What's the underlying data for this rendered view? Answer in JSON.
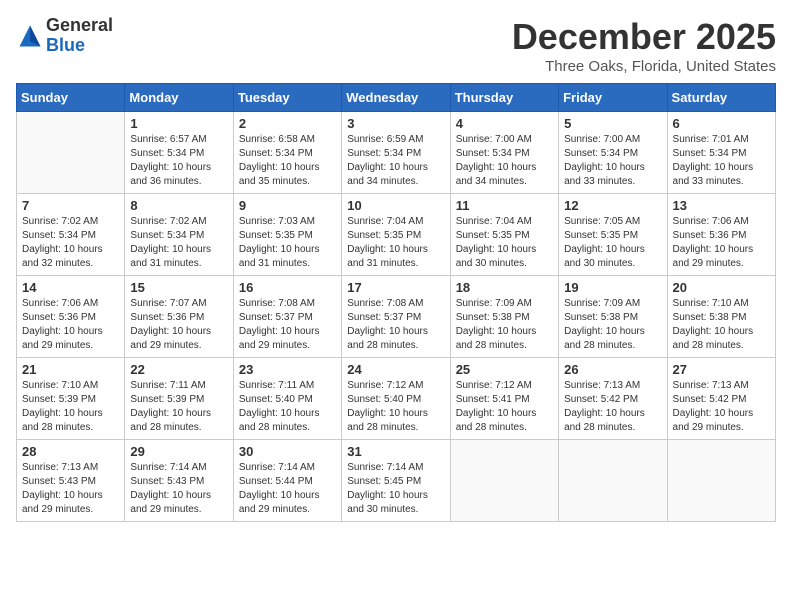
{
  "logo": {
    "general": "General",
    "blue": "Blue"
  },
  "title": "December 2025",
  "location": "Three Oaks, Florida, United States",
  "headers": [
    "Sunday",
    "Monday",
    "Tuesday",
    "Wednesday",
    "Thursday",
    "Friday",
    "Saturday"
  ],
  "weeks": [
    [
      {
        "num": "",
        "sunrise": "",
        "sunset": "",
        "daylight": ""
      },
      {
        "num": "1",
        "sunrise": "Sunrise: 6:57 AM",
        "sunset": "Sunset: 5:34 PM",
        "daylight": "Daylight: 10 hours and 36 minutes."
      },
      {
        "num": "2",
        "sunrise": "Sunrise: 6:58 AM",
        "sunset": "Sunset: 5:34 PM",
        "daylight": "Daylight: 10 hours and 35 minutes."
      },
      {
        "num": "3",
        "sunrise": "Sunrise: 6:59 AM",
        "sunset": "Sunset: 5:34 PM",
        "daylight": "Daylight: 10 hours and 34 minutes."
      },
      {
        "num": "4",
        "sunrise": "Sunrise: 7:00 AM",
        "sunset": "Sunset: 5:34 PM",
        "daylight": "Daylight: 10 hours and 34 minutes."
      },
      {
        "num": "5",
        "sunrise": "Sunrise: 7:00 AM",
        "sunset": "Sunset: 5:34 PM",
        "daylight": "Daylight: 10 hours and 33 minutes."
      },
      {
        "num": "6",
        "sunrise": "Sunrise: 7:01 AM",
        "sunset": "Sunset: 5:34 PM",
        "daylight": "Daylight: 10 hours and 33 minutes."
      }
    ],
    [
      {
        "num": "7",
        "sunrise": "Sunrise: 7:02 AM",
        "sunset": "Sunset: 5:34 PM",
        "daylight": "Daylight: 10 hours and 32 minutes."
      },
      {
        "num": "8",
        "sunrise": "Sunrise: 7:02 AM",
        "sunset": "Sunset: 5:34 PM",
        "daylight": "Daylight: 10 hours and 31 minutes."
      },
      {
        "num": "9",
        "sunrise": "Sunrise: 7:03 AM",
        "sunset": "Sunset: 5:35 PM",
        "daylight": "Daylight: 10 hours and 31 minutes."
      },
      {
        "num": "10",
        "sunrise": "Sunrise: 7:04 AM",
        "sunset": "Sunset: 5:35 PM",
        "daylight": "Daylight: 10 hours and 31 minutes."
      },
      {
        "num": "11",
        "sunrise": "Sunrise: 7:04 AM",
        "sunset": "Sunset: 5:35 PM",
        "daylight": "Daylight: 10 hours and 30 minutes."
      },
      {
        "num": "12",
        "sunrise": "Sunrise: 7:05 AM",
        "sunset": "Sunset: 5:35 PM",
        "daylight": "Daylight: 10 hours and 30 minutes."
      },
      {
        "num": "13",
        "sunrise": "Sunrise: 7:06 AM",
        "sunset": "Sunset: 5:36 PM",
        "daylight": "Daylight: 10 hours and 29 minutes."
      }
    ],
    [
      {
        "num": "14",
        "sunrise": "Sunrise: 7:06 AM",
        "sunset": "Sunset: 5:36 PM",
        "daylight": "Daylight: 10 hours and 29 minutes."
      },
      {
        "num": "15",
        "sunrise": "Sunrise: 7:07 AM",
        "sunset": "Sunset: 5:36 PM",
        "daylight": "Daylight: 10 hours and 29 minutes."
      },
      {
        "num": "16",
        "sunrise": "Sunrise: 7:08 AM",
        "sunset": "Sunset: 5:37 PM",
        "daylight": "Daylight: 10 hours and 29 minutes."
      },
      {
        "num": "17",
        "sunrise": "Sunrise: 7:08 AM",
        "sunset": "Sunset: 5:37 PM",
        "daylight": "Daylight: 10 hours and 28 minutes."
      },
      {
        "num": "18",
        "sunrise": "Sunrise: 7:09 AM",
        "sunset": "Sunset: 5:38 PM",
        "daylight": "Daylight: 10 hours and 28 minutes."
      },
      {
        "num": "19",
        "sunrise": "Sunrise: 7:09 AM",
        "sunset": "Sunset: 5:38 PM",
        "daylight": "Daylight: 10 hours and 28 minutes."
      },
      {
        "num": "20",
        "sunrise": "Sunrise: 7:10 AM",
        "sunset": "Sunset: 5:38 PM",
        "daylight": "Daylight: 10 hours and 28 minutes."
      }
    ],
    [
      {
        "num": "21",
        "sunrise": "Sunrise: 7:10 AM",
        "sunset": "Sunset: 5:39 PM",
        "daylight": "Daylight: 10 hours and 28 minutes."
      },
      {
        "num": "22",
        "sunrise": "Sunrise: 7:11 AM",
        "sunset": "Sunset: 5:39 PM",
        "daylight": "Daylight: 10 hours and 28 minutes."
      },
      {
        "num": "23",
        "sunrise": "Sunrise: 7:11 AM",
        "sunset": "Sunset: 5:40 PM",
        "daylight": "Daylight: 10 hours and 28 minutes."
      },
      {
        "num": "24",
        "sunrise": "Sunrise: 7:12 AM",
        "sunset": "Sunset: 5:40 PM",
        "daylight": "Daylight: 10 hours and 28 minutes."
      },
      {
        "num": "25",
        "sunrise": "Sunrise: 7:12 AM",
        "sunset": "Sunset: 5:41 PM",
        "daylight": "Daylight: 10 hours and 28 minutes."
      },
      {
        "num": "26",
        "sunrise": "Sunrise: 7:13 AM",
        "sunset": "Sunset: 5:42 PM",
        "daylight": "Daylight: 10 hours and 28 minutes."
      },
      {
        "num": "27",
        "sunrise": "Sunrise: 7:13 AM",
        "sunset": "Sunset: 5:42 PM",
        "daylight": "Daylight: 10 hours and 29 minutes."
      }
    ],
    [
      {
        "num": "28",
        "sunrise": "Sunrise: 7:13 AM",
        "sunset": "Sunset: 5:43 PM",
        "daylight": "Daylight: 10 hours and 29 minutes."
      },
      {
        "num": "29",
        "sunrise": "Sunrise: 7:14 AM",
        "sunset": "Sunset: 5:43 PM",
        "daylight": "Daylight: 10 hours and 29 minutes."
      },
      {
        "num": "30",
        "sunrise": "Sunrise: 7:14 AM",
        "sunset": "Sunset: 5:44 PM",
        "daylight": "Daylight: 10 hours and 29 minutes."
      },
      {
        "num": "31",
        "sunrise": "Sunrise: 7:14 AM",
        "sunset": "Sunset: 5:45 PM",
        "daylight": "Daylight: 10 hours and 30 minutes."
      },
      {
        "num": "",
        "sunrise": "",
        "sunset": "",
        "daylight": ""
      },
      {
        "num": "",
        "sunrise": "",
        "sunset": "",
        "daylight": ""
      },
      {
        "num": "",
        "sunrise": "",
        "sunset": "",
        "daylight": ""
      }
    ]
  ]
}
